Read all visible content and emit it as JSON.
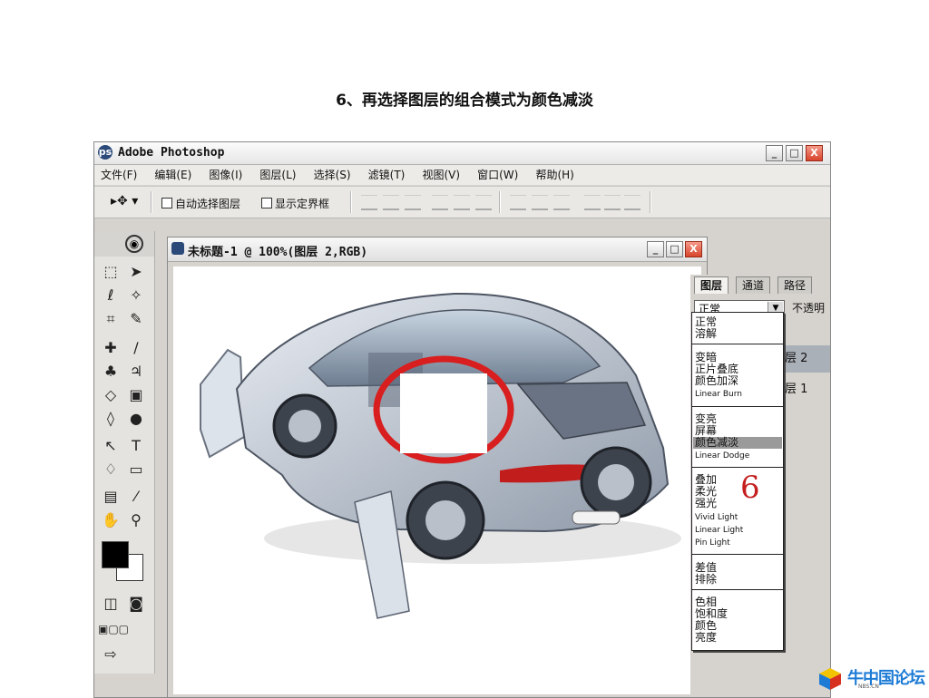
{
  "caption": "6、再选择图层的组合模式为颜色减淡",
  "app": {
    "title": "Adobe Photoshop",
    "window_buttons": [
      "_",
      "□",
      "X"
    ]
  },
  "menu": [
    "文件(F)",
    "编辑(E)",
    "图像(I)",
    "图层(L)",
    "选择(S)",
    "滤镜(T)",
    "视图(V)",
    "窗口(W)",
    "帮助(H)"
  ],
  "options": {
    "tool": "▸✥ ▾",
    "auto_select": "自动选择图层",
    "show_bounds": "显示定界框"
  },
  "document": {
    "title": "未标题-1 @ 100%(图层 2,RGB)"
  },
  "layers_panel": {
    "tabs": [
      "图层",
      "通道",
      "路径"
    ],
    "blend_mode": "正常",
    "opacity_label": "不透明",
    "layer_rows": [
      "层 2",
      "层 1"
    ]
  },
  "blend_dropdown": {
    "groups": [
      [
        "正常",
        "溶解"
      ],
      [
        "变暗",
        "正片叠底",
        "颜色加深",
        "Linear Burn"
      ],
      [
        "变亮",
        "屏幕",
        "颜色减淡",
        "Linear Dodge"
      ],
      [
        "叠加",
        "柔光",
        "强光",
        "Vivid Light",
        "Linear Light",
        "Pin Light"
      ],
      [
        "差值",
        "排除"
      ],
      [
        "色相",
        "饱和度",
        "颜色",
        "亮度"
      ]
    ],
    "selected": "颜色减淡"
  },
  "step_annotation": "6",
  "logo": {
    "text": "牛中国论坛",
    "sub": "NBS.CN"
  },
  "colors": {
    "red_circle": "#d81e1e",
    "highlight": "#9a9a9a"
  }
}
